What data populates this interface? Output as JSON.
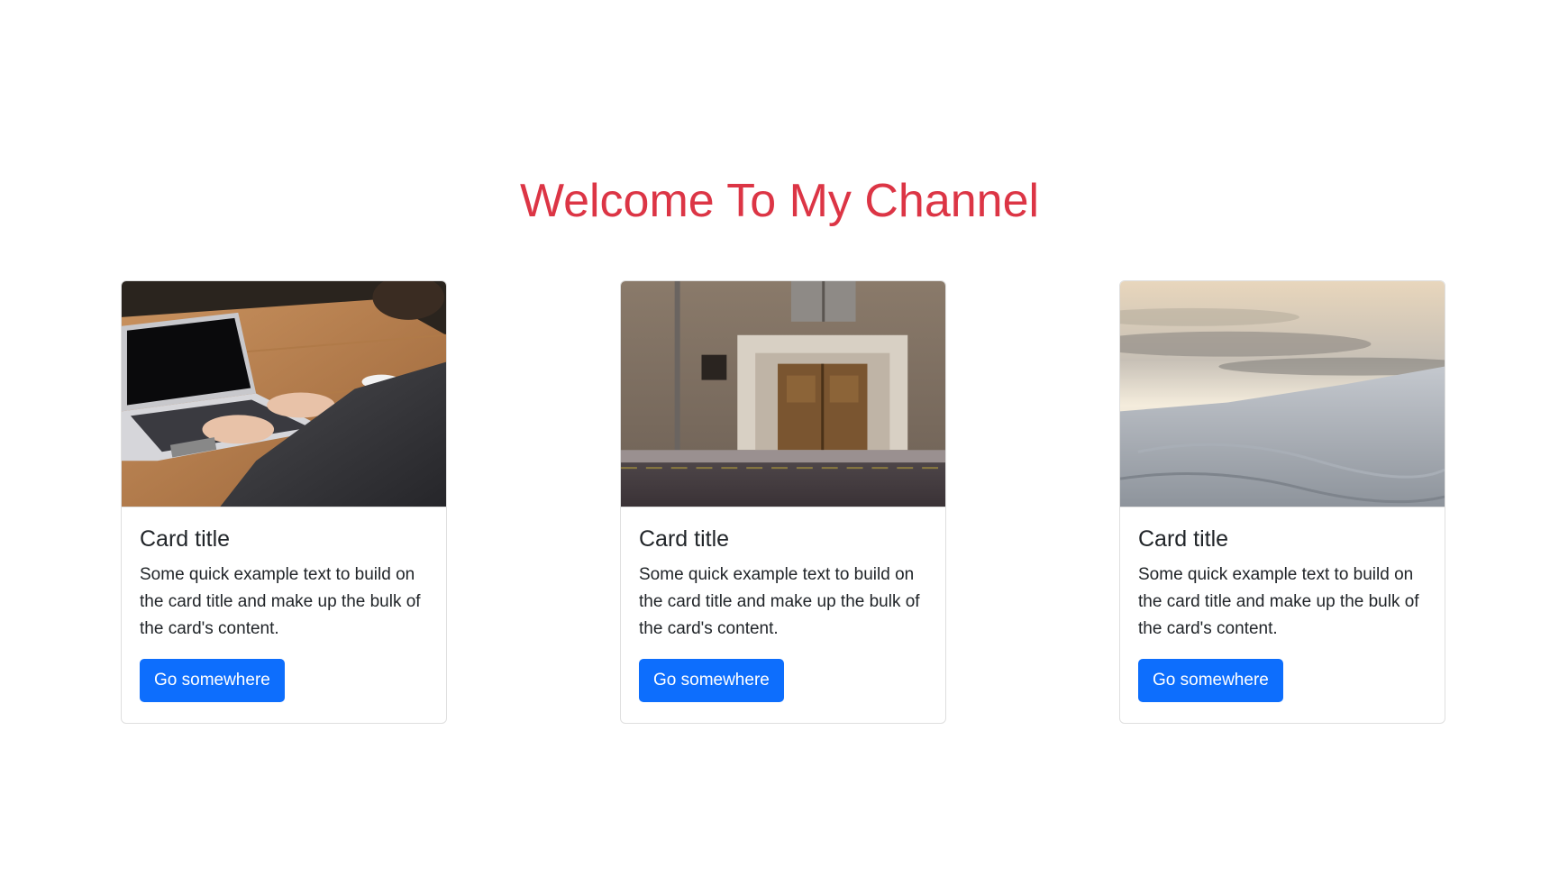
{
  "page": {
    "heading": "Welcome To My Channel",
    "heading_color": "#dc3545"
  },
  "cards": [
    {
      "image": "laptop-photo",
      "title": "Card title",
      "text": "Some quick example text to build on the card title and make up the bulk of the card's content.",
      "button": "Go somewhere"
    },
    {
      "image": "old-door-photo",
      "title": "Card title",
      "text": "Some quick example text to build on the card title and make up the bulk of the card's content.",
      "button": "Go somewhere"
    },
    {
      "image": "snow-landscape-photo",
      "title": "Card title",
      "text": "Some quick example text to build on the card title and make up the bulk of the card's content.",
      "button": "Go somewhere"
    }
  ],
  "colors": {
    "button": "#0d6efd",
    "card_border": "#dfdfdf"
  }
}
